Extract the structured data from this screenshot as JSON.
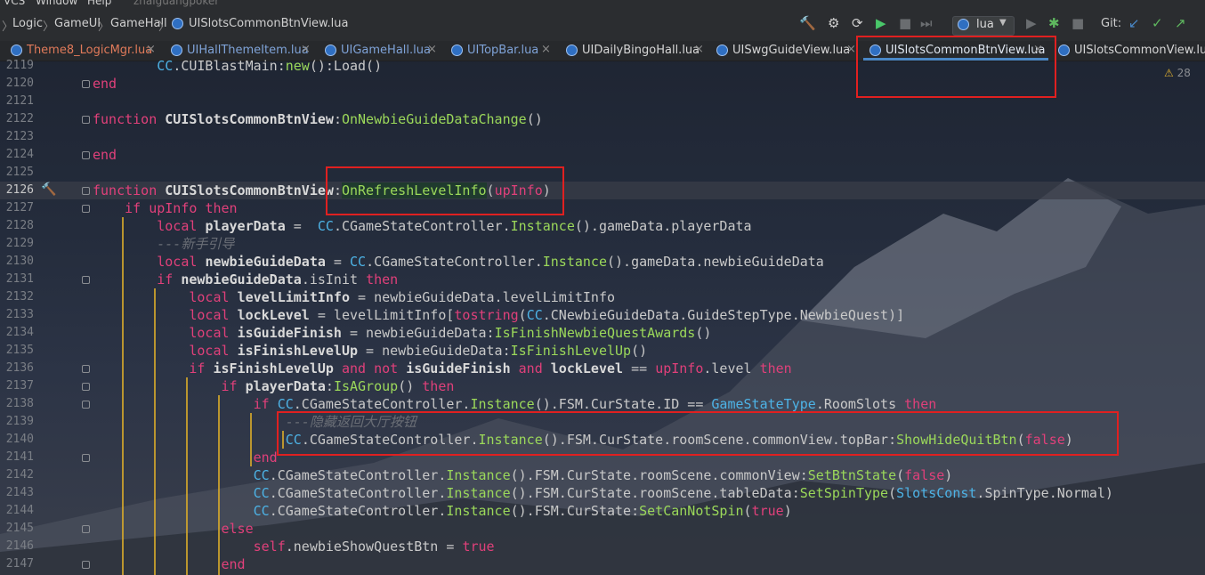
{
  "menu": {
    "vcs": "VCS",
    "window": "Window",
    "help": "Help",
    "project": "zhaiguangpoker"
  },
  "breadcrumb": [
    "Logic",
    "GameUI",
    "GameHall",
    "UISlotsCommonBtnView.lua"
  ],
  "toolbar": {
    "run_config": "lua",
    "git_label": "Git:"
  },
  "tabs": [
    {
      "label": "Theme8_LogicMgr.lua",
      "closable": true
    },
    {
      "label": "UIHallThemeItem.lua",
      "closable": true
    },
    {
      "label": "UIGameHall.lua",
      "closable": true
    },
    {
      "label": "UITopBar.lua",
      "closable": true
    },
    {
      "label": "UIDailyBingoHall.lua",
      "closable": true
    },
    {
      "label": "UISwgGuideView.lua",
      "closable": true
    },
    {
      "label": "UISlotsCommonBtnView.lua",
      "closable": true,
      "active": true
    },
    {
      "label": "UISlotsCommonView.lua",
      "closable": false
    }
  ],
  "inspection": {
    "warning_count": "28"
  },
  "editor": {
    "current_line": "2126",
    "line_numbers": [
      "2119",
      "2120",
      "2121",
      "2122",
      "2123",
      "2124",
      "2125",
      "2126",
      "2127",
      "2128",
      "2129",
      "2130",
      "2131",
      "2132",
      "2133",
      "2134",
      "2135",
      "2136",
      "2137",
      "2138",
      "2139",
      "2140",
      "2141",
      "2142",
      "2143",
      "2144",
      "2145",
      "2146",
      "2147"
    ],
    "lines": [
      "        CC.CUIBlastMain:new():Load()",
      "end",
      "",
      "function CUISlotsCommonBtnView:OnNewbieGuideDataChange()",
      "",
      "end",
      "",
      "function CUISlotsCommonBtnView:OnRefreshLevelInfo(upInfo)",
      "    if upInfo then",
      "        local playerData =  CC.CGameStateController.Instance().gameData.playerData",
      "        ---新手引导",
      "        local newbieGuideData = CC.CGameStateController.Instance().gameData.newbieGuideData",
      "        if newbieGuideData.isInit then",
      "            local levelLimitInfo = newbieGuideData.levelLimitInfo",
      "            local lockLevel = levelLimitInfo[tostring(CC.CNewbieGuideData.GuideStepType.NewbieQuest)]",
      "            local isGuideFinish = newbieGuideData:IsFinishNewbieQuestAwards()",
      "            local isFinishLevelUp = newbieGuideData:IsFinishLevelUp()",
      "            if isFinishLevelUp and not isGuideFinish and lockLevel == upInfo.level then",
      "                if playerData:IsAGroup() then",
      "                    if CC.CGameStateController.Instance().FSM.CurState.ID == GameStateType.RoomSlots then",
      "                        ---隐藏返回大厅按钮",
      "                        CC.CGameStateController.Instance().FSM.CurState.roomScene.commonView.topBar:ShowHideQuitBtn(false)",
      "                    end",
      "                    CC.CGameStateController.Instance().FSM.CurState.roomScene.commonView:SetBtnState(false)",
      "                    CC.CGameStateController.Instance().FSM.CurState.roomScene.tableData:SetSpinType(SlotsConst.SpinType.Normal)",
      "                    CC.CGameStateController.Instance().FSM.CurState:SetCanNotSpin(true)",
      "                else",
      "                    self.newbieShowQuestBtn = true",
      "                end"
    ]
  }
}
